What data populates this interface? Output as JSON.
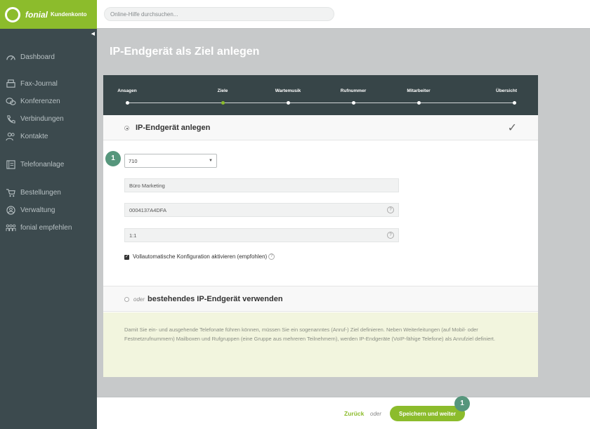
{
  "app": {
    "brand": "fonial",
    "subtitle": "Kundenkonto"
  },
  "search": {
    "placeholder": "Online-Hilfe durchsuchen..."
  },
  "sidebar": {
    "collapse_icon": "triangle-left-icon",
    "items": [
      {
        "label": "Dashboard",
        "icon": "speedometer-icon"
      },
      {
        "label": "Fax-Journal",
        "icon": "fax-icon"
      },
      {
        "label": "Konferenzen",
        "icon": "chat-bubbles-icon"
      },
      {
        "label": "Verbindungen",
        "icon": "phone-icon"
      },
      {
        "label": "Kontakte",
        "icon": "people-icon"
      },
      {
        "label": "Telefonanlage",
        "icon": "pbx-icon"
      },
      {
        "label": "Bestellungen",
        "icon": "cart-icon"
      },
      {
        "label": "Verwaltung",
        "icon": "user-circle-icon"
      },
      {
        "label": "fonial empfehlen",
        "icon": "share-people-icon"
      }
    ]
  },
  "page": {
    "title": "IP-Endgerät als Ziel anlegen"
  },
  "stepper": {
    "steps": [
      {
        "label": "Ansagen",
        "active": false
      },
      {
        "label": "Ziele",
        "active": true
      },
      {
        "label": "Wartemusik",
        "active": false
      },
      {
        "label": "Rufnummer",
        "active": false
      },
      {
        "label": "Mitarbeiter",
        "active": false
      },
      {
        "label": "Übersicht",
        "active": false
      }
    ],
    "active_color": "#8cbc2c"
  },
  "section_new": {
    "title": "IP-Endgerät anlegen",
    "selected": true
  },
  "form": {
    "badge": "1",
    "extension_select": "710",
    "name_value": "Büro Marketing",
    "mac_value": "0004137A4DFA",
    "port_value": "1:1",
    "help_glyph": "?",
    "auto_config_label": "Vollautomatische Konfiguration aktivieren (empfohlen)",
    "auto_config_checked": true
  },
  "section_existing": {
    "oder": "oder",
    "title": "bestehendes IP-Endgerät verwenden",
    "selected": false
  },
  "info": {
    "text": "Damit Sie ein- und ausgehende Telefonate führen können, müssen Sie ein sogenanntes (Anruf-) Ziel definieren. Neben Weiterleitungen (auf Mobil- oder Festnetzrufnummern) Mailboxen und Rufgruppen (eine Gruppe aus mehreren Teilnehmern), werden IP-Endgeräte (VoIP-fähige Telefone) als Anrufziel definiert."
  },
  "footer": {
    "back_label": "Zurück",
    "oder": "oder",
    "save_label": "Speichern und weiter",
    "badge": "1"
  },
  "colors": {
    "brand_green": "#8cbc2c",
    "sidebar_bg": "#3c4a4e",
    "stepper_bg": "#374548",
    "badge_teal": "#56967c",
    "info_bg": "#f2f5de"
  }
}
